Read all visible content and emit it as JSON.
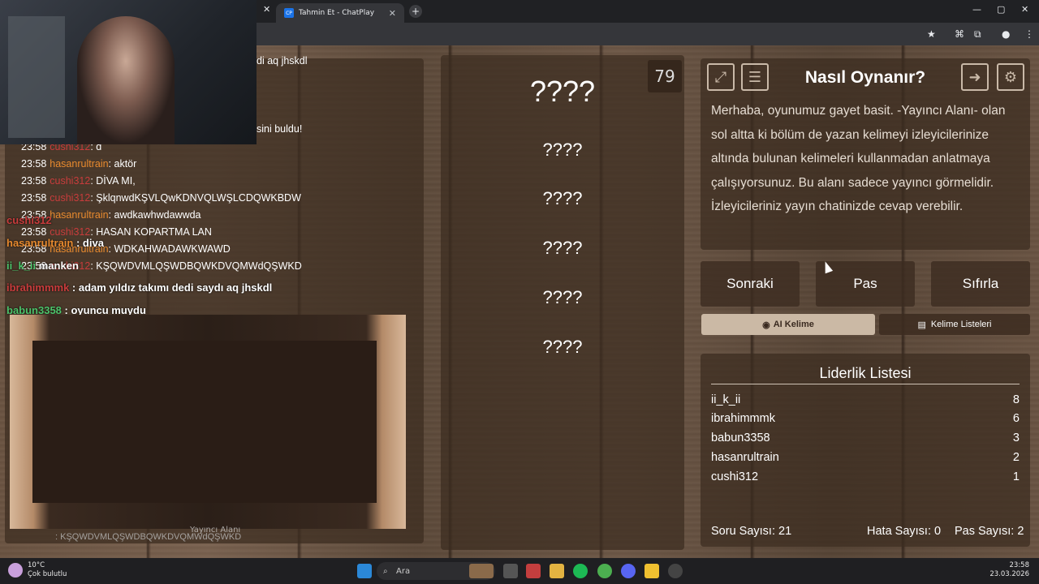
{
  "browser": {
    "tab_title": "Tahmin Et - ChatPlay",
    "tab_favicon": "CP",
    "new_tab": "+",
    "window_controls": [
      "—",
      "▢",
      "✕"
    ]
  },
  "chat": {
    "top_partial_1": "di aq jhskdl",
    "top_partial_2": "sini buldu!",
    "lines": [
      {
        "time": "23:58",
        "user": "cushi312",
        "msg": ": d"
      },
      {
        "time": "23:58",
        "user": "hasanrultrain",
        "msg": ": aktör"
      },
      {
        "time": "23:58",
        "user": "cushi312",
        "msg": ": DİVA MI,"
      },
      {
        "time": "23:58",
        "user": "cushi312",
        "msg": ": ŞklqnwdKŞVLQwKDNVQLWŞLCDQWKBDW"
      },
      {
        "time": "23:58",
        "user": "hasanrultrain",
        "msg": ": awdkawhwdawwda"
      },
      {
        "time": "23:58",
        "user": "cushi312",
        "msg": ": HASAN KOPARTMA LAN"
      },
      {
        "time": "23:58",
        "user": "hasanrultrain",
        "msg": ": WDKAHWADAWKWAWD"
      },
      {
        "time": "23:58",
        "user": "cushi312",
        "msg": ": KŞQWDVMLQŞWDBQWKDVQMWdQŞWKD"
      }
    ],
    "overlay_lines": [
      {
        "user": "cushi312",
        "msg": ""
      },
      {
        "user": "hasanrultrain",
        "msg": " : diva"
      },
      {
        "user": "ii_k_ii",
        "msg": " manken"
      },
      {
        "user": "ibrahimmmk",
        "msg": " : adam yıldız takımı dedi saydı aq jhskdl"
      },
      {
        "user": "babun3358",
        "msg": " : oyuncu muydu"
      }
    ],
    "footer_line": ": KŞQWDVMLQŞWDBQWKDVQMWdQŞWKD",
    "footer_label": "Yayıncı Alanı"
  },
  "game": {
    "counter": "79",
    "words": [
      "????",
      "????",
      "????",
      "????",
      "????",
      "????"
    ]
  },
  "right_panel": {
    "title": "Nasıl Oynanır?",
    "description": "Merhaba, oyunumuz gayet basit. -Yayıncı Alanı- olan sol altta ki bölüm de yazan kelimeyi izleyicilerinize altında bulunan kelimeleri kullanmadan anlatmaya çalışıyorsunuz. Bu alanı sadece yayıncı görmelidir. İzleyicileriniz yayın chatinizde cevap verebilir.",
    "buttons": {
      "next": "Sonraki",
      "pass": "Pas",
      "reset": "Sıfırla"
    },
    "ai_button": "AI Kelime",
    "word_lists_button": "Kelime Listeleri",
    "icons": {
      "fullscreen": "expand-icon",
      "notes": "document-icon",
      "exit": "exit-icon",
      "settings": "gear-icon"
    }
  },
  "leaderboard": {
    "title": "Liderlik Listesi",
    "rows": [
      {
        "name": "ii_k_ii",
        "score": "8"
      },
      {
        "name": "ibrahimmmk",
        "score": "6"
      },
      {
        "name": "babun3358",
        "score": "3"
      },
      {
        "name": "hasanrultrain",
        "score": "2"
      },
      {
        "name": "cushi312",
        "score": "1"
      }
    ]
  },
  "stats": {
    "questions": "Soru Sayısı: 21",
    "errors": "Hata Sayısı: 0",
    "passes": "Pas Sayısı: 2"
  },
  "taskbar": {
    "temp": "10°C",
    "weather": "Çok bulutlu",
    "search": "Ara",
    "time": "23:58",
    "date": "23.03.2026"
  },
  "colors": {
    "accent_orange": "#e88a2e",
    "accent_red": "#c83c3c",
    "ai_button_bg": "#cbb9a5"
  }
}
